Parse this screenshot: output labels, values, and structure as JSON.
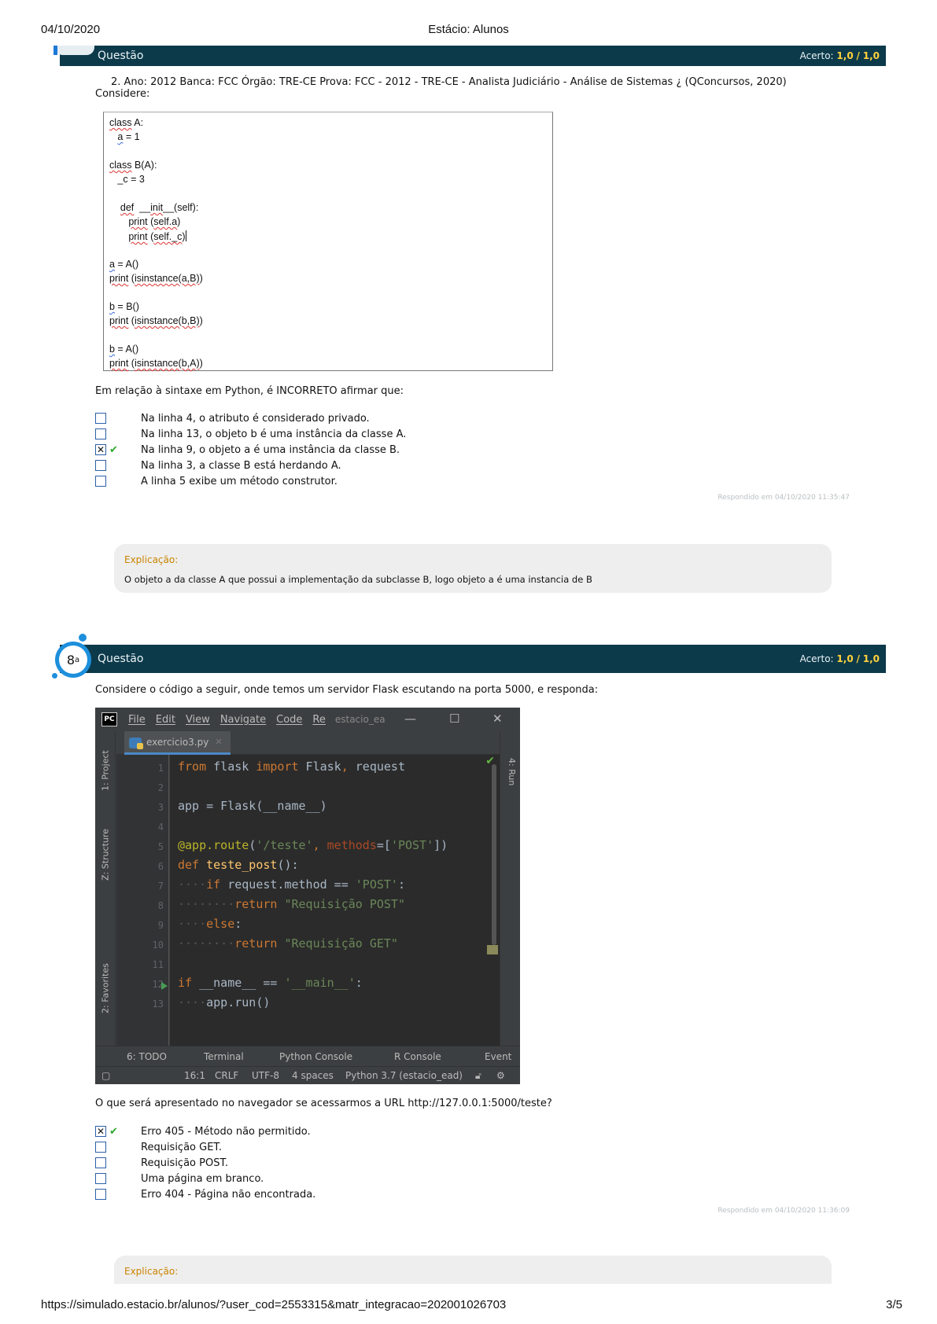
{
  "print_header": {
    "date": "04/10/2020",
    "title": "Estácio: Alunos"
  },
  "print_footer": {
    "url": "https://simulado.estacio.br/alunos/?user_cod=2553315&matr_integracao=202001026703",
    "page": "3/5"
  },
  "question7": {
    "bar_label": "Questão",
    "acerto_label": "Acerto:",
    "acerto_value": "1,0",
    "acerto_sep": "/",
    "acerto_total": "1,0",
    "source": "2. Ano: 2012 Banca: FCC Órgão: TRE-CE Prova: FCC - 2012 - TRE-CE - Analista Judiciário - Análise de Sistemas ¿ (QConcursos, 2020)",
    "considere": "Considere:",
    "code_lines": [
      "class A:",
      "   a = 1",
      "",
      "class B(A):",
      "   _c = 3",
      "",
      "    def __init__(self):",
      "       print (self.a)",
      "       print (self._c)",
      "",
      "a = A()",
      "print (isinstance(a,B))",
      "",
      "b = B()",
      "print (isinstance(b,B))",
      "",
      "b = A()",
      "print (isinstance(b,A))"
    ],
    "prompt": "Em relação à sintaxe em Python, é INCORRETO afirmar que:",
    "options": [
      {
        "text": "Na linha 4, o atributo é considerado privado.",
        "checked": false
      },
      {
        "text": "Na linha 13, o objeto b é uma instância da classe A.",
        "checked": false
      },
      {
        "text": "Na linha 9, o objeto a é uma instância da classe B.",
        "checked": true
      },
      {
        "text": "Na linha 3, a classe B está herdando A.",
        "checked": false
      },
      {
        "text": "A linha 5 exibe um método construtor.",
        "checked": false
      }
    ],
    "respondido": "Respondido em 04/10/2020 11:35:47",
    "explicacao_title": "Explicação:",
    "explicacao_body": "O objeto a da classe A que possui a implementação da subclasse B, logo objeto a é uma instancia de B"
  },
  "question8": {
    "number": "8",
    "number_sup": "a",
    "bar_label": "Questão",
    "acerto_label": "Acerto:",
    "acerto_value": "1,0",
    "acerto_sep": "/",
    "acerto_total": "1,0",
    "intro": "Considere o código a seguir, onde temos um servidor Flask escutando na porta 5000, e responda:",
    "ide": {
      "logo": "PC",
      "menus": [
        "File",
        "Edit",
        "View",
        "Navigate",
        "Code",
        "Re"
      ],
      "project": "estacio_ea",
      "tab": "exercicio3.py",
      "side_tabs": [
        "1: Project",
        "Z: Structure",
        "2: Favorites"
      ],
      "right_tab": "4: Run",
      "bottom_tabs": [
        "6: TODO",
        "Terminal",
        "Python Console",
        "R Console",
        "Event"
      ],
      "status": [
        "16:1",
        "CRLF",
        "UTF-8",
        "4 spaces",
        "Python 3.7 (estacio_ead)"
      ]
    },
    "question": "O que será apresentado no navegador se acessarmos a URL http://127.0.0.1:5000/teste?",
    "options": [
      {
        "text": "Erro 405 - Método não permitido.",
        "checked": true
      },
      {
        "text": "Requisição GET.",
        "checked": false
      },
      {
        "text": "Requisição POST.",
        "checked": false
      },
      {
        "text": "Uma página em branco.",
        "checked": false
      },
      {
        "text": "Erro 404 - Página não encontrada.",
        "checked": false
      }
    ],
    "respondido": "Respondido em 04/10/2020 11:36:09",
    "explicacao_title": "Explicação:"
  },
  "colors": {
    "bar": "#0d3a4a",
    "acerto": "#ffd23c",
    "explicacao": "#c98400",
    "badge": "#1d8fdc",
    "check": "#2aa52a"
  }
}
